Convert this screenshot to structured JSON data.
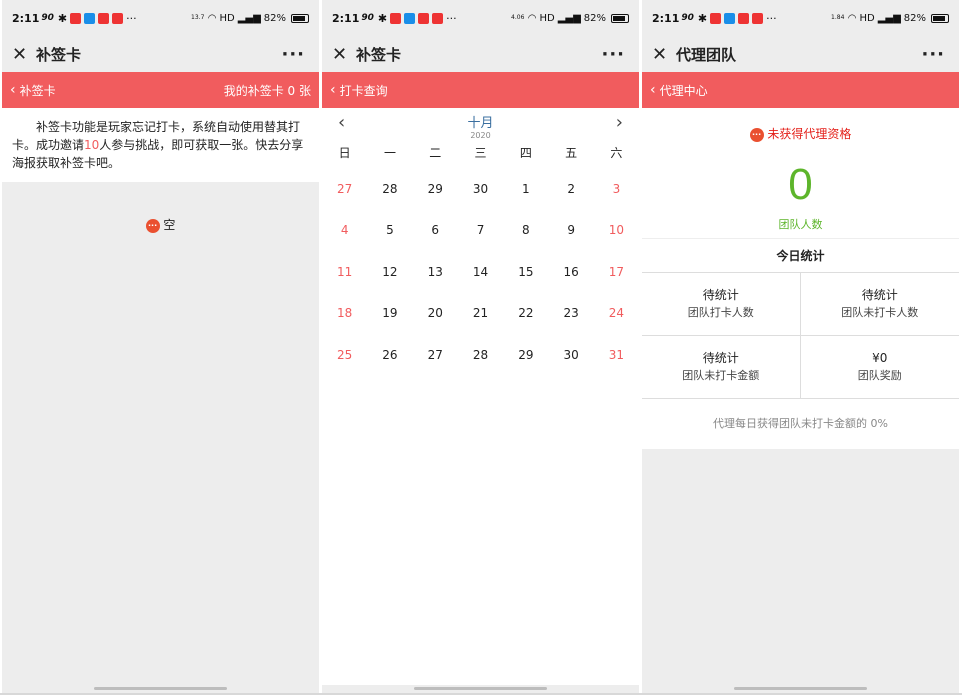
{
  "status": {
    "time": "2:11",
    "speed_kb": "90",
    "right_text": "HD",
    "battery": "82%",
    "net": [
      "13.7",
      "4.06",
      "1.84"
    ]
  },
  "colors": {
    "accent_red": "#f15c5e",
    "green": "#5db52b",
    "title_blue": "#3a6fa0"
  },
  "icons": {
    "close": "close-icon",
    "more": "more-dots-icon",
    "back": "chevron-left-icon",
    "prev": "chevron-left-icon",
    "next": "chevron-right-icon",
    "notice": "red-dots-icon"
  },
  "screen1": {
    "title": "补签卡",
    "header_left": "补签卡",
    "header_right": "我的补签卡 0 张",
    "desc_part1": "补签卡功能是玩家忘记打卡，系统自动使用替其打卡。成功邀请",
    "desc_highlight": "10",
    "desc_part2": "人参与挑战，即可获取一张。快去分享海报获取补签卡吧。",
    "empty_text": "空"
  },
  "screen2": {
    "title": "补签卡",
    "header_left": "打卡查询",
    "month": "十月",
    "year": "2020",
    "weekdays": [
      "日",
      "一",
      "二",
      "三",
      "四",
      "五",
      "六"
    ],
    "weeks": [
      [
        "27",
        "28",
        "29",
        "30",
        "1",
        "2",
        "3"
      ],
      [
        "4",
        "5",
        "6",
        "7",
        "8",
        "9",
        "10"
      ],
      [
        "11",
        "12",
        "13",
        "14",
        "15",
        "16",
        "17"
      ],
      [
        "18",
        "19",
        "20",
        "21",
        "22",
        "23",
        "24"
      ],
      [
        "25",
        "26",
        "27",
        "28",
        "29",
        "30",
        "31"
      ]
    ]
  },
  "screen3": {
    "title": "代理团队",
    "header_left": "代理中心",
    "not_qualified": "未获得代理资格",
    "team_count": "0",
    "team_count_label": "团队人数",
    "today_title": "今日统计",
    "stats": [
      {
        "value": "待统计",
        "label": "团队打卡人数"
      },
      {
        "value": "待统计",
        "label": "团队未打卡人数"
      },
      {
        "value": "待统计",
        "label": "团队未打卡金额"
      },
      {
        "value": "¥0",
        "label": "团队奖励"
      }
    ],
    "footnote": "代理每日获得团队未打卡金额的 0%"
  }
}
